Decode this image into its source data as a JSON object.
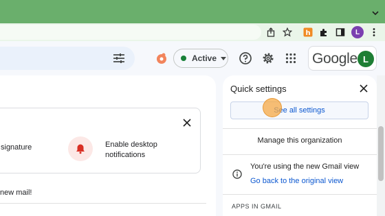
{
  "browser": {
    "toolbar_icons": [
      "share-icon",
      "bookmark-star-icon",
      "extension-hunter-icon",
      "extensions-puzzle-icon",
      "side-panel-icon",
      "profile-avatar",
      "browser-menu-icon"
    ],
    "profile_initial": "L"
  },
  "header": {
    "status_label": "Active",
    "status_color": "#188038",
    "brand": "Google",
    "account_initial": "L",
    "account_color": "#1e7e34"
  },
  "main": {
    "card": {
      "signature_text": "signature",
      "notification_text": "Enable desktop notifications"
    },
    "new_mail_text": "new mail!"
  },
  "quick_settings": {
    "title": "Quick settings",
    "see_all_label": "See all settings",
    "manage_label": "Manage this organization",
    "using_new_view": "You're using the new Gmail view",
    "go_back_link": "Go back to the original view",
    "apps_heading": "APPS IN GMAIL"
  },
  "colors": {
    "accent_blue": "#0b57d0",
    "frame_green": "#6aaf6c",
    "bell_red": "#d93025"
  }
}
